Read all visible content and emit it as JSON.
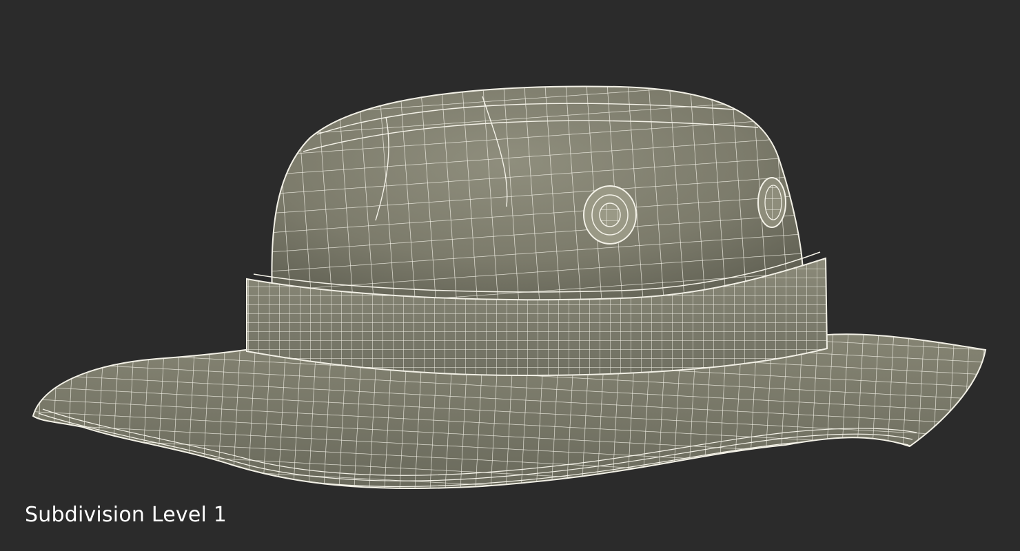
{
  "caption": "Subdivision Level 1",
  "model": {
    "subject": "bucket-hat",
    "display_mode": "wireframe-on-shaded"
  },
  "colors": {
    "background": "#2b2b2b",
    "surface": "#8a8a78",
    "wire": "#f2f0e6",
    "caption": "#ffffff"
  }
}
